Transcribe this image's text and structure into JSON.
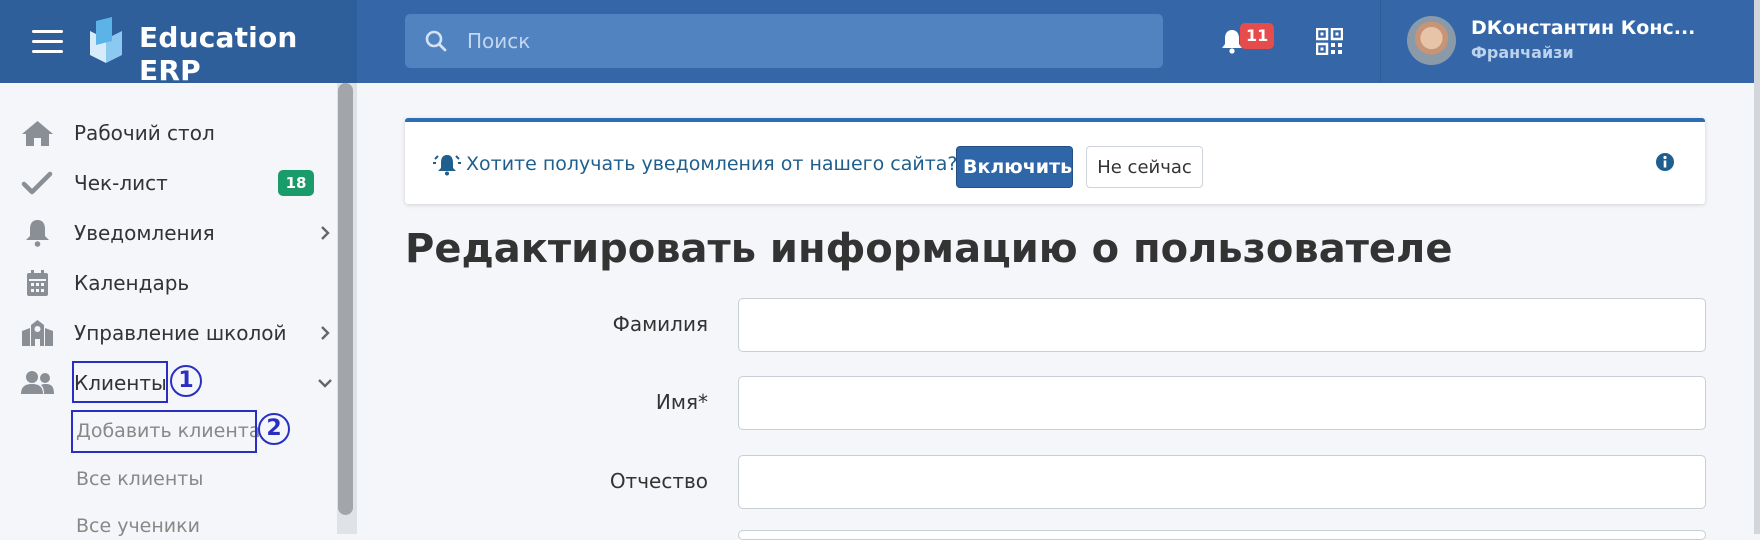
{
  "app": {
    "brand": "Education ERP",
    "accent": "#3466a8",
    "brand_bg": "#2f5f9b"
  },
  "topbar": {
    "search_placeholder": "Поиск",
    "notifications_count": "11",
    "user_name": "DКонстантин Конс...",
    "user_role": "Франчайзи"
  },
  "sidebar": {
    "items": [
      {
        "label": "Рабочий стол",
        "icon": "home-icon"
      },
      {
        "label": "Чек-лист",
        "icon": "check-icon",
        "badge": "18"
      },
      {
        "label": "Уведомления",
        "icon": "bell-icon"
      },
      {
        "label": "Календарь",
        "icon": "calendar-icon"
      },
      {
        "label": "Управление школой",
        "icon": "school-icon"
      },
      {
        "label": "Клиенты",
        "icon": "users-icon"
      }
    ],
    "clients_sub": [
      "Добавить клиента",
      "Все клиенты",
      "Все ученики"
    ],
    "annotations": [
      "1",
      "2"
    ]
  },
  "alert": {
    "text": "Хотите получать уведомления от нашего сайта?",
    "enable_button": "Включить",
    "later_button": "Не сейчас"
  },
  "main": {
    "title": "Редактировать информацию о пользователе",
    "fields": [
      {
        "label": "Фамилия",
        "value": ""
      },
      {
        "label": "Имя*",
        "value": ""
      },
      {
        "label": "Отчество",
        "value": ""
      }
    ]
  }
}
